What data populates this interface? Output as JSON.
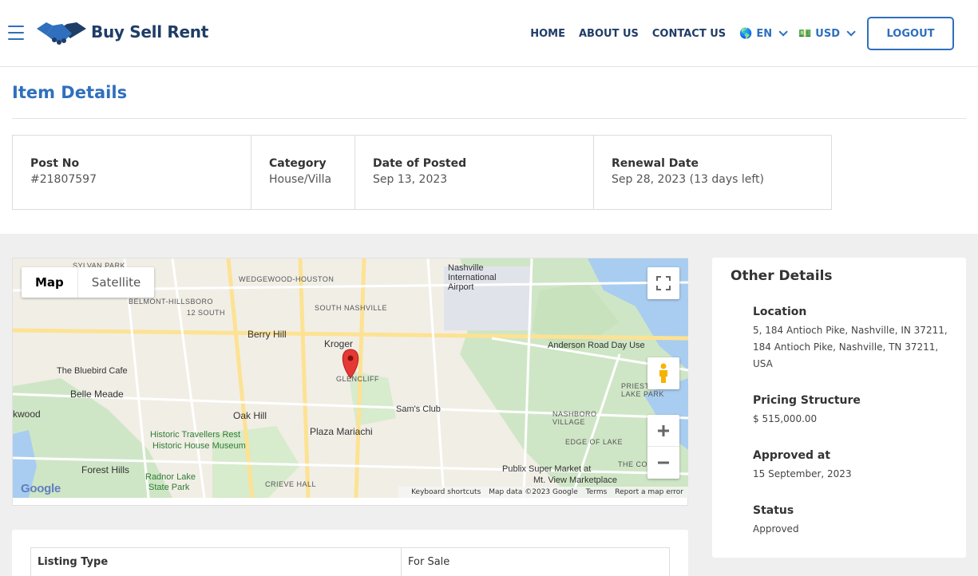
{
  "brand": {
    "name": "Buy Sell Rent"
  },
  "nav": {
    "home": "HOME",
    "about": "ABOUT US",
    "contact": "CONTACT US",
    "language": {
      "flag": "🌎",
      "code": "EN"
    },
    "currency": {
      "flag": "💵",
      "code": "USD"
    },
    "logout": "LOGOUT"
  },
  "page": {
    "title": "Item Details"
  },
  "summary": [
    {
      "label": "Post No",
      "value": "#21807597"
    },
    {
      "label": "Category",
      "value": "House/Villa"
    },
    {
      "label": "Date of Posted",
      "value": "Sep 13, 2023"
    },
    {
      "label": "Renewal Date",
      "value": "Sep 28, 2023 (13 days left)"
    }
  ],
  "map": {
    "type_map": "Map",
    "type_satellite": "Satellite",
    "google": "Google",
    "footer": {
      "shortcuts": "Keyboard shortcuts",
      "data": "Map data ©2023 Google",
      "terms": "Terms",
      "report": "Report a map error"
    },
    "labels": {
      "sylvan_park": "SYLVAN PARK",
      "wedgewood": "WEDGEWOOD-HOUSTON",
      "belmont": "BELMONT-HILLSBORO",
      "twelve_south": "12 SOUTH",
      "south_nashville": "SOUTH NASHVILLE",
      "berry_hill": "Berry Hill",
      "kroger": "Kroger",
      "glencliff": "GLENCLIFF",
      "bluebird": "The Bluebird Cafe",
      "belle_meade": "Belle Meade",
      "oak_hill": "Oak Hill",
      "historic_travellers": "Historic Travellers Rest",
      "historic_house": "Historic House Museum",
      "plaza_mariachi": "Plaza Mariachi",
      "sams_club": "Sam's Club",
      "forest_hills": "Forest Hills",
      "radnor": "Radnor Lake",
      "radnor2": "State Park",
      "crieve": "CRIEVE HALL",
      "airport": "Nashville International Airport",
      "anderson": "Anderson Road Day Use",
      "priest_lake": "PRIEST LAKE PARK",
      "nashboro": "NASHBORO VILLAGE",
      "edge_lake": "EDGE OF LAKE",
      "publix": "Publix Super Market at",
      "publix2": "Mt. View Marketplace",
      "wood": "kwood",
      "cove": "THE COVE"
    }
  },
  "other": {
    "title": "Other Details",
    "location_label": "Location",
    "location_value": "5, 184 Antioch Pike, Nashville, IN 37211, 184 Antioch Pike, Nashville, TN 37211, USA",
    "pricing_label": "Pricing Structure",
    "pricing_value": "$ 515,000.00",
    "approved_label": "Approved at",
    "approved_value": "15 September, 2023",
    "status_label": "Status",
    "status_value": "Approved"
  },
  "listing": {
    "type_label": "Listing Type",
    "type_value": "For Sale"
  },
  "colors": {
    "primary": "#2f6fbd",
    "navy": "#1f3d67",
    "map_marker": "#e53935"
  }
}
